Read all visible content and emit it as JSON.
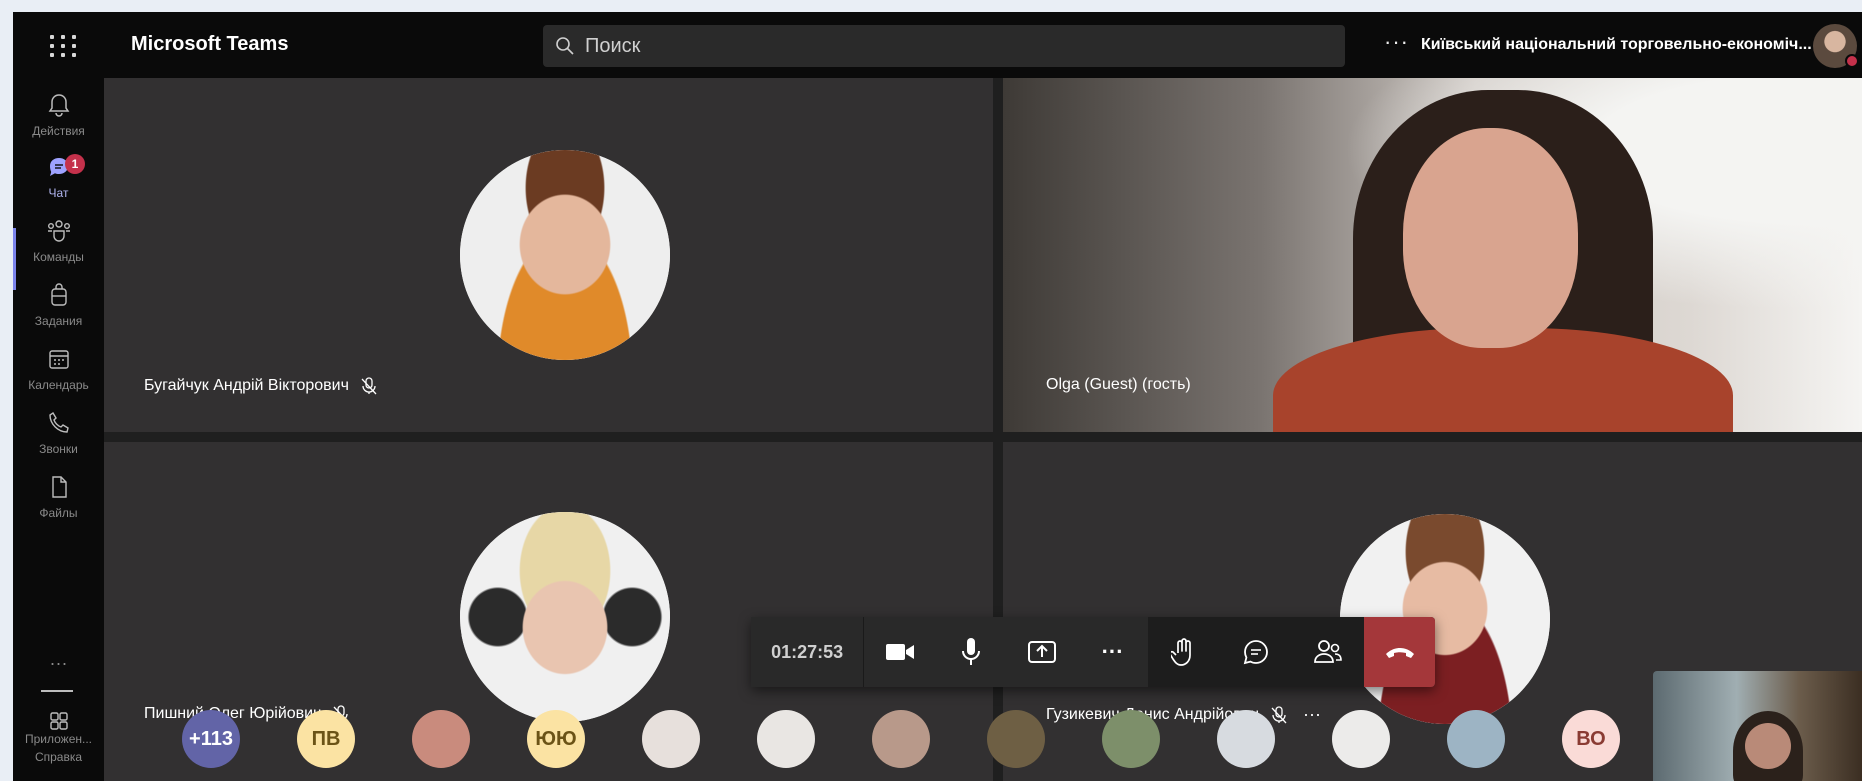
{
  "app": {
    "brand": "Microsoft Teams"
  },
  "search": {
    "placeholder": "Поиск"
  },
  "header": {
    "more": "···",
    "org": "Київський національний торговельно-економіч..."
  },
  "rail": {
    "items": [
      {
        "label": "Действия",
        "icon": "bell-icon"
      },
      {
        "label": "Чат",
        "icon": "chat-icon",
        "badge": "1",
        "active": true
      },
      {
        "label": "Команды",
        "icon": "teams-icon"
      },
      {
        "label": "Задания",
        "icon": "assignments-icon"
      },
      {
        "label": "Календарь",
        "icon": "calendar-icon"
      },
      {
        "label": "Звонки",
        "icon": "phone-icon"
      },
      {
        "label": "Файлы",
        "icon": "file-icon"
      }
    ],
    "more": "···",
    "apps_label": "Приложен...",
    "help_label": "Справка"
  },
  "tiles": [
    {
      "name": "Бугайчук Андрій Вікторович",
      "muted": true
    },
    {
      "name": "Olga (Guest) (гость)",
      "muted": false
    },
    {
      "name": "Пишний Олег Юрійович",
      "muted": true
    },
    {
      "name": "Гузикевич Денис Андрійович",
      "muted": true,
      "more": "···"
    }
  ],
  "toolbar": {
    "timer": "01:27:53",
    "more": "···",
    "buttons": [
      "camera-icon",
      "mic-icon",
      "share-screen-icon",
      "more-icon",
      "raise-hand-icon",
      "chat-icon",
      "participants-icon",
      "hang-up-icon"
    ]
  },
  "roster": {
    "items": [
      {
        "text": "+113",
        "bg": "#6264a7",
        "fg": "#ffffff"
      },
      {
        "text": "ПВ",
        "bg": "#fbe3a3",
        "fg": "#6b5316"
      },
      {
        "text": "",
        "bg": "#c98b7d"
      },
      {
        "text": "ЮЮ",
        "bg": "#fbe3a3",
        "fg": "#6b5316"
      },
      {
        "text": "",
        "bg": "#e7e0dc"
      },
      {
        "text": "",
        "bg": "#e9e6e3"
      },
      {
        "text": "",
        "bg": "#b8998a"
      },
      {
        "text": "",
        "bg": "#6e5f44"
      },
      {
        "text": "",
        "bg": "#7d8f6a"
      },
      {
        "text": "",
        "bg": "#d7dbe0"
      },
      {
        "text": "",
        "bg": "#ecebea"
      },
      {
        "text": "",
        "bg": "#9db4c4"
      },
      {
        "text": "ВО",
        "bg": "#fadbd7",
        "fg": "#8a3b33"
      }
    ]
  }
}
